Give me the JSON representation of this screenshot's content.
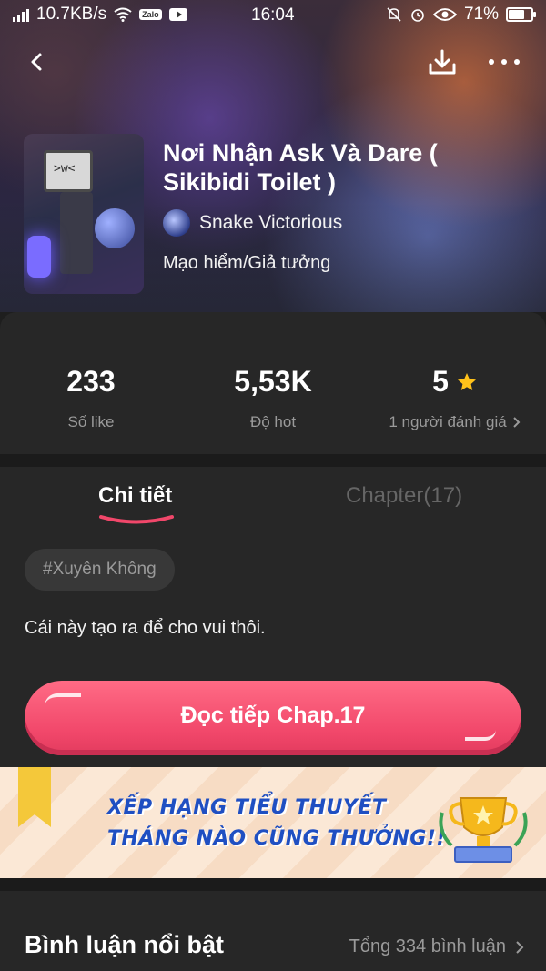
{
  "status_bar": {
    "speed": "10.7KB/s",
    "zalo_badge": "Zalo",
    "time": "16:04",
    "battery": "71%",
    "battery_level": 0.71
  },
  "story": {
    "title": "Nơi Nhận Ask Và Dare ( Sikibidi Toilet )",
    "author": "Snake Victorious",
    "genre": "Mạo hiểm/Giả tưởng"
  },
  "stats": {
    "likes_value": "233",
    "likes_label": "Số like",
    "hot_value": "5,53K",
    "hot_label": "Độ hot",
    "rating_value": "5",
    "rating_label": "1 người đánh giá"
  },
  "tabs": {
    "detail": "Chi tiết",
    "chapter": "Chapter(17)"
  },
  "tag": "#Xuyên Không",
  "description": "Cái này tạo ra để cho vui thôi.",
  "read_button": "Đọc tiếp Chap.17",
  "banner": {
    "line1": "XẾP HẠNG TIỂU THUYẾT",
    "line2": "THÁNG NÀO CŨNG THƯỞNG!!"
  },
  "comments": {
    "title": "Bình luận nổi bật",
    "total": "Tổng 334 bình luận"
  },
  "colors": {
    "accent": "#f1476a",
    "star": "#ffc21a",
    "banner_text": "#1f4fc2"
  }
}
